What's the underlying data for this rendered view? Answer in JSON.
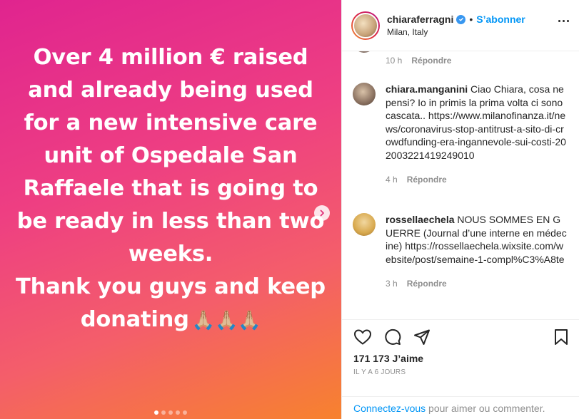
{
  "media": {
    "lines": [
      "Over 4 million € raised",
      "and already being used",
      "for a new intensive care",
      "unit of Ospedale San",
      "Raffaele that is going to",
      "be ready in less than two",
      "weeks.",
      "Thank you guys and keep",
      "donating"
    ],
    "emoji": "🙏🏼🙏🏼🙏🏼",
    "slide_count": 5,
    "active_slide": 1
  },
  "header": {
    "username": "chiaraferragni",
    "follow_separator": "•",
    "follow_label": "S’abonner",
    "location": "Milan, Italy"
  },
  "comments": [
    {
      "time": "10 h",
      "reply": "Répondre"
    },
    {
      "username": "chiara.manganini",
      "text": "Ciao Chiara, cosa ne pensi? Io in primis la prima volta ci sono cascata.. https://www.milanofinanza.it/news/coronavirus-stop-antitrust-a-sito-di-crowdfunding-era-ingannevole-sui-costi-202003221419249010",
      "time": "4 h",
      "reply": "Répondre"
    },
    {
      "username": "rossellaechela",
      "text": "NOUS SOMMES EN GUERRE (Journal d’une interne en médecine) https://rossellaechela.wixsite.com/website/post/semaine-1-compl%C3%A8te",
      "time": "3 h",
      "reply": "Répondre"
    }
  ],
  "footer": {
    "likes": "171 173 J’aime",
    "posted": "IL Y A 6 JOURS",
    "login_link": "Connectez-vous",
    "login_text": " pour aimer ou commenter."
  }
}
